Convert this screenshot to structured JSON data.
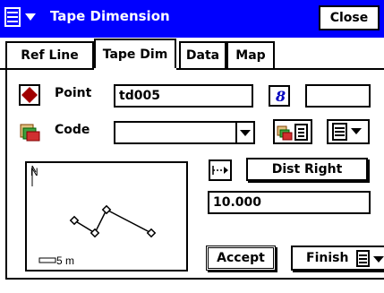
{
  "window": {
    "title": "Tape Dimension",
    "close_label": "Close",
    "accent_color": "#0000ff"
  },
  "tabs": [
    {
      "label": "Ref Line",
      "active": false
    },
    {
      "label": "Tape Dim",
      "active": true
    },
    {
      "label": "Data",
      "active": false
    },
    {
      "label": "Map",
      "active": false
    }
  ],
  "form": {
    "point_label": "Point",
    "point_value": "td005",
    "code_label": "Code",
    "code_value": "",
    "distance_mode": "Dist Right",
    "distance_value": "10.000"
  },
  "map": {
    "north_label": "N",
    "scale_label": "5 m"
  },
  "buttons": {
    "accept": "Accept",
    "finish": "Finish"
  }
}
